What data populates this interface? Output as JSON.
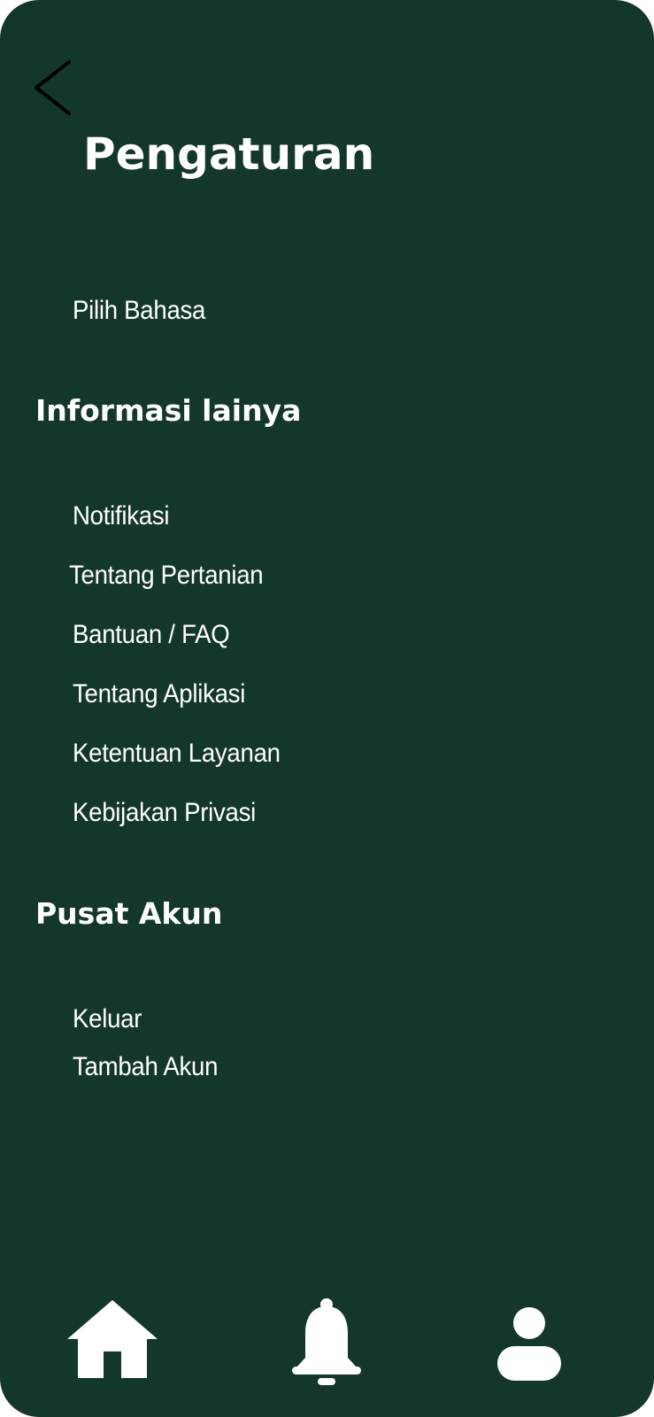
{
  "header": {
    "title": "Pengaturan",
    "back_icon": "chevron-left-icon"
  },
  "general": {
    "items": [
      {
        "label": "Pilih Bahasa"
      }
    ]
  },
  "info_section": {
    "heading": "Informasi lainya",
    "items": [
      {
        "label": "Notifikasi"
      },
      {
        "label": "Tentang Pertanian"
      },
      {
        "label": "Bantuan / FAQ"
      },
      {
        "label": "Tentang Aplikasi"
      },
      {
        "label": "Ketentuan Layanan"
      },
      {
        "label": "Kebijakan Privasi"
      }
    ]
  },
  "account_section": {
    "heading": "Pusat Akun",
    "items": [
      {
        "label": "Keluar"
      },
      {
        "label": "Tambah Akun"
      }
    ]
  },
  "bottom_nav": {
    "items": [
      {
        "icon": "home-icon"
      },
      {
        "icon": "bell-icon"
      },
      {
        "icon": "user-icon"
      }
    ]
  },
  "colors": {
    "background": "#14372c",
    "text": "#ffffff",
    "back_arrow": "#000000"
  }
}
